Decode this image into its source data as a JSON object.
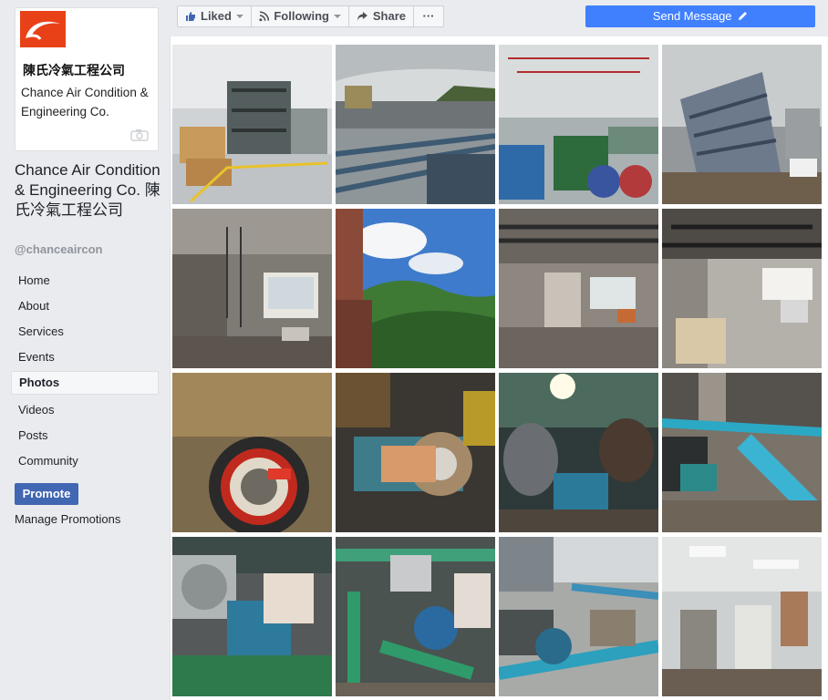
{
  "page": {
    "logo_zh": "陳氏冷氣工程公司",
    "logo_en": "Chance Air Condition & Engineering Co.",
    "name": "Chance Air Condition & Engineering Co. 陳氏冷氣工程公司",
    "handle": "@chanceaircon"
  },
  "nav": {
    "items": [
      "Home",
      "About",
      "Services",
      "Events",
      "Photos",
      "Videos",
      "Posts",
      "Community"
    ],
    "active": "Photos"
  },
  "promote_label": "Promote",
  "manage_promotions_label": "Manage Promotions",
  "actions": {
    "liked": "Liked",
    "following": "Following",
    "share": "Share",
    "more": "···",
    "send_message": "Send Message"
  },
  "colors": {
    "brand_orange": "#e84118",
    "facebook_blue": "#4267b2",
    "send_button": "#4080ff"
  },
  "photos": [
    {
      "scene": "warehouse-racks"
    },
    {
      "scene": "rooftop-pipes"
    },
    {
      "scene": "factory-floor"
    },
    {
      "scene": "building-exterior"
    },
    {
      "scene": "construction-interior"
    },
    {
      "scene": "mountain-view"
    },
    {
      "scene": "ceiling-ducts"
    },
    {
      "scene": "cement-bags-room"
    },
    {
      "scene": "bearing-closeup"
    },
    {
      "scene": "motor-repair"
    },
    {
      "scene": "workers-repair"
    },
    {
      "scene": "blue-pipes-roof"
    },
    {
      "scene": "pump-motor"
    },
    {
      "scene": "green-pump-pipes"
    },
    {
      "scene": "rooftop-pump-area"
    },
    {
      "scene": "office-interior"
    }
  ]
}
